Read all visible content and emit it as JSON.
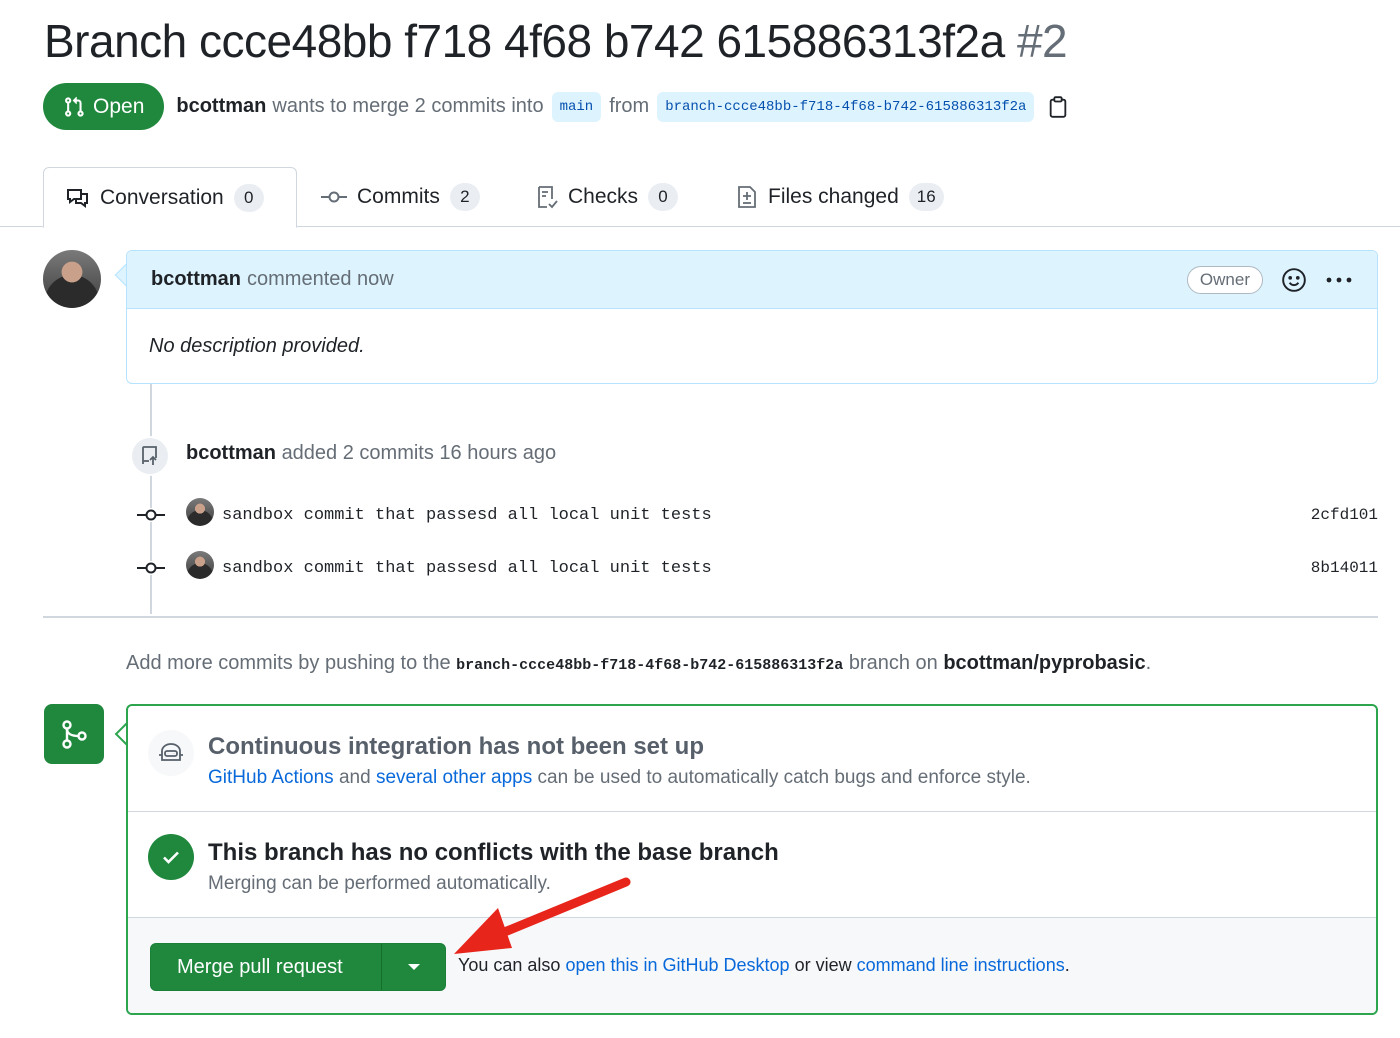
{
  "title": {
    "text": "Branch ccce48bb f718 4f68 b742 615886313f2a",
    "number": "#2"
  },
  "meta": {
    "state": "Open",
    "author": "bcottman",
    "action_text": "wants to merge 2 commits into",
    "base_branch": "main",
    "from_text": "from",
    "head_branch": "branch-ccce48bb-f718-4f68-b742-615886313f2a"
  },
  "tabs": [
    {
      "label": "Conversation",
      "count": "0"
    },
    {
      "label": "Commits",
      "count": "2"
    },
    {
      "label": "Checks",
      "count": "0"
    },
    {
      "label": "Files changed",
      "count": "16"
    }
  ],
  "comment": {
    "author": "bcottman",
    "action": "commented now",
    "badge": "Owner",
    "body": "No description provided."
  },
  "timeline": {
    "author": "bcottman",
    "text": "added 2 commits 16 hours ago",
    "commits": [
      {
        "message": "sandbox commit that passesd all local unit tests",
        "sha": "2cfd101"
      },
      {
        "message": "sandbox commit that passesd all local unit tests",
        "sha": "8b14011"
      }
    ]
  },
  "push_hint": {
    "prefix": "Add more commits by pushing to the",
    "branch": "branch-ccce48bb-f718-4f68-b742-615886313f2a",
    "middle": "branch on",
    "repo": "bcottman/pyprobasic",
    "suffix": "."
  },
  "merge_box": {
    "ci_title": "Continuous integration has not been set up",
    "ci_link1": "GitHub Actions",
    "ci_and": "and",
    "ci_link2": "several other apps",
    "ci_rest": "can be used to automatically catch bugs and enforce style.",
    "ok_title": "This branch has no conflicts with the base branch",
    "ok_sub": "Merging can be performed automatically.",
    "merge_button": "Merge pull request",
    "note_prefix": "You can also",
    "note_link1": "open this in GitHub Desktop",
    "note_mid": "or view",
    "note_link2": "command line instructions",
    "note_suffix": "."
  },
  "colors": {
    "green": "#1f883d",
    "blue": "#0969da",
    "annotation_arrow": "#e8251b"
  }
}
